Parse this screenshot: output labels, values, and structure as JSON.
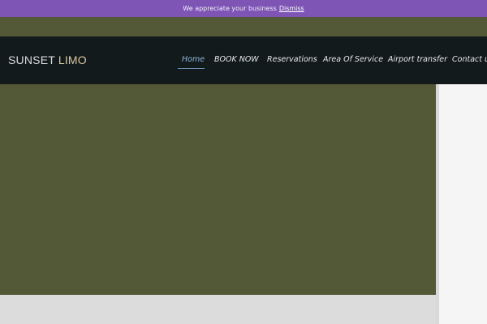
{
  "notice": {
    "message": "We appreciate your business",
    "dismiss_label": "Dismiss"
  },
  "brand": {
    "word1": "SUNSET",
    "word2": "LIMO"
  },
  "nav": {
    "items": [
      {
        "label": "Home",
        "active": true
      },
      {
        "label": "BOOK NOW",
        "active": false
      },
      {
        "label": "Reservations",
        "active": false
      },
      {
        "label": "Area Of Service",
        "active": false
      },
      {
        "label": "Airport transfer",
        "active": false
      },
      {
        "label": "Contact us",
        "active": false
      }
    ]
  },
  "colors": {
    "notice_bg": "#7e55b5",
    "header_bg": "#131a1b",
    "page_bg": "#535837",
    "active_nav": "#8fb6dd",
    "logo_accent": "#d9c8a2"
  }
}
